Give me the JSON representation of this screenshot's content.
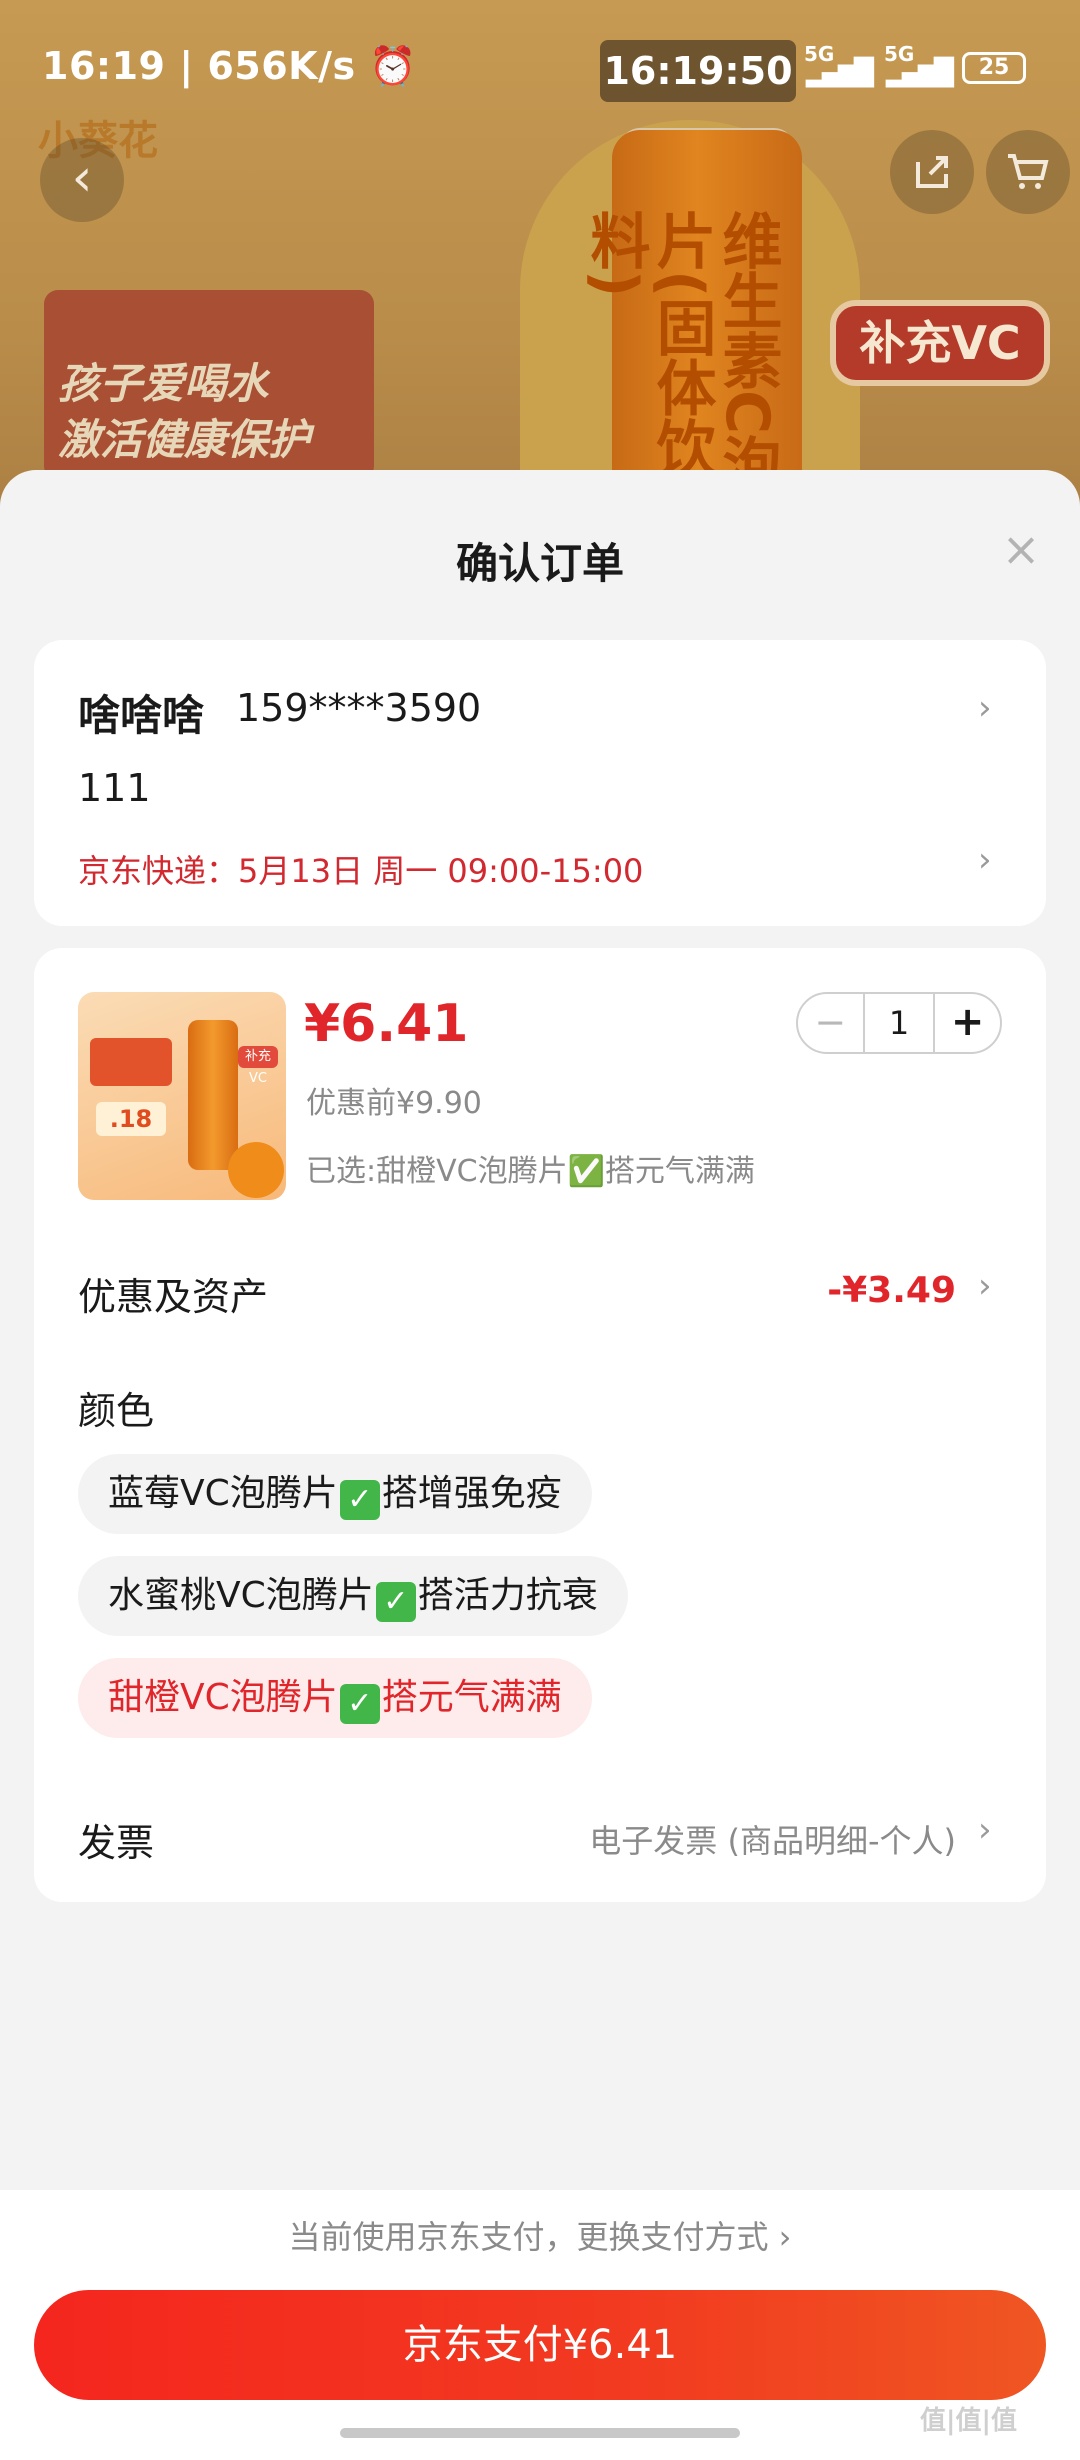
{
  "status_bar": {
    "time": "16:19",
    "speed": "656K/s",
    "clock_overlay": "16:19:50",
    "network_1": "5G",
    "network_2": "5G",
    "battery": "25"
  },
  "background": {
    "brand_logo": "小葵花",
    "banner_text_1": "孩子爱喝水",
    "banner_text_2": "激活健康保护",
    "product_text": "维生素C泡腾片(固体饮料)",
    "badge": "补充VC",
    "icons": [
      "back-arrow-icon",
      "share-icon",
      "cart-icon"
    ]
  },
  "sheet": {
    "title": "确认订单",
    "close_icon": "×"
  },
  "address": {
    "name": "啥啥啥",
    "phone": "159****3590",
    "detail": "111",
    "delivery": "京东快递：5月13日 周一 09:00-15:00"
  },
  "product": {
    "price": "¥6.41",
    "original_price": "优惠前¥9.90",
    "selected": "已选:甜橙VC泡腾片✅搭元气满满",
    "quantity": "1",
    "image_price_tag": ".18",
    "image_badge": "补充VC"
  },
  "discount": {
    "label": "优惠及资产",
    "value": "-¥3.49"
  },
  "color_section": {
    "label": "颜色",
    "options": [
      {
        "label_a": "蓝莓VC泡腾片",
        "label_b": "搭增强免疫",
        "selected": false
      },
      {
        "label_a": "水蜜桃VC泡腾片",
        "label_b": "搭活力抗衰",
        "selected": false
      },
      {
        "label_a": "甜橙VC泡腾片",
        "label_b": "搭元气满满",
        "selected": true
      }
    ]
  },
  "invoice": {
    "label": "发票",
    "value": "电子发票 (商品明细-个人)"
  },
  "payment": {
    "switch_text": "当前使用京东支付，更换支付方式 ›",
    "pay_button": "京东支付¥6.41"
  },
  "watermark": "值|值|值"
}
